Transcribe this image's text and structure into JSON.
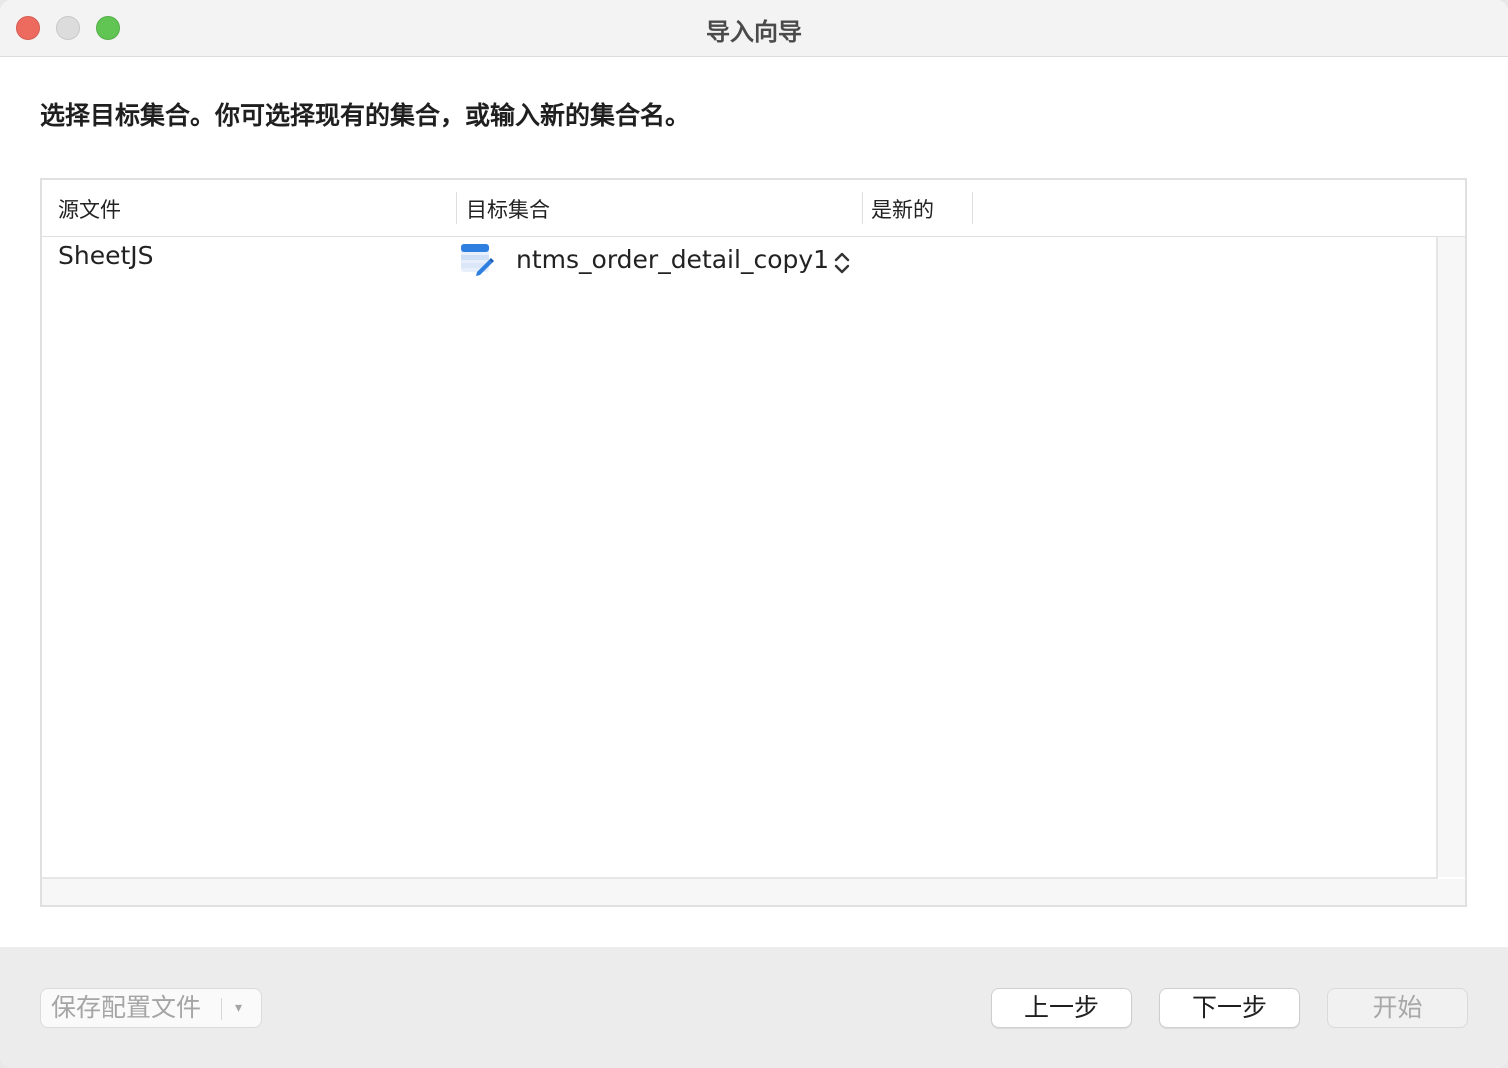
{
  "window": {
    "title": "导入向导",
    "controls": [
      "close",
      "minimize",
      "maximize"
    ]
  },
  "instruction": "选择目标集合。你可选择现有的集合，或输入新的集合名。",
  "table": {
    "columns": [
      "源文件",
      "目标集合",
      "是新的"
    ],
    "rows": [
      {
        "source": "SheetJS",
        "target": "ntms_order_detail_copy1",
        "target_icon": "collection-edit-icon",
        "is_new": ""
      }
    ]
  },
  "footer": {
    "save_profile": "保存配置文件",
    "save_dropdown_icon": "▾",
    "back": "上一步",
    "next": "下一步",
    "start": "开始"
  },
  "colors": {
    "close": "#ed6a5e",
    "minimize": "#dcdcdc",
    "maximize": "#61c554",
    "icon_blue": "#2f7fe0"
  }
}
